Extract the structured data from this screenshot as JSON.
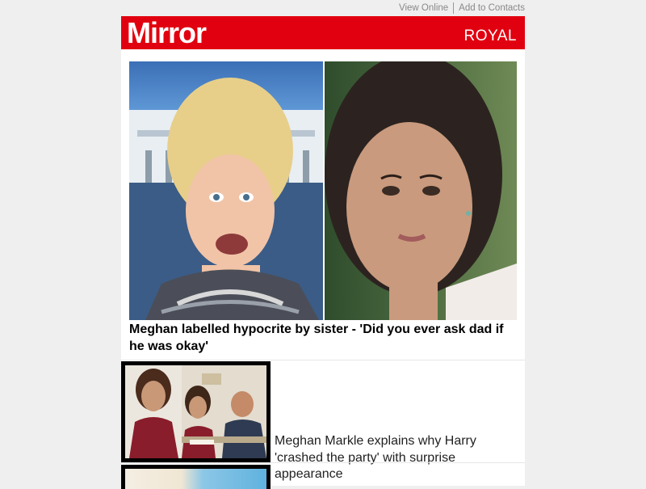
{
  "header_links": {
    "view_online": "View Online",
    "add_to_contacts": "Add to Contacts"
  },
  "masthead": {
    "logo": "Mirror",
    "section": "ROYAL",
    "brand_color": "#e1000f"
  },
  "lead_story": {
    "headline": "Meghan labelled hypocrite by sister - 'Did you ever ask dad if he was okay'"
  },
  "stories": [
    {
      "title": "Meghan Markle explains why Harry 'crashed the party' with surprise appearance"
    }
  ]
}
